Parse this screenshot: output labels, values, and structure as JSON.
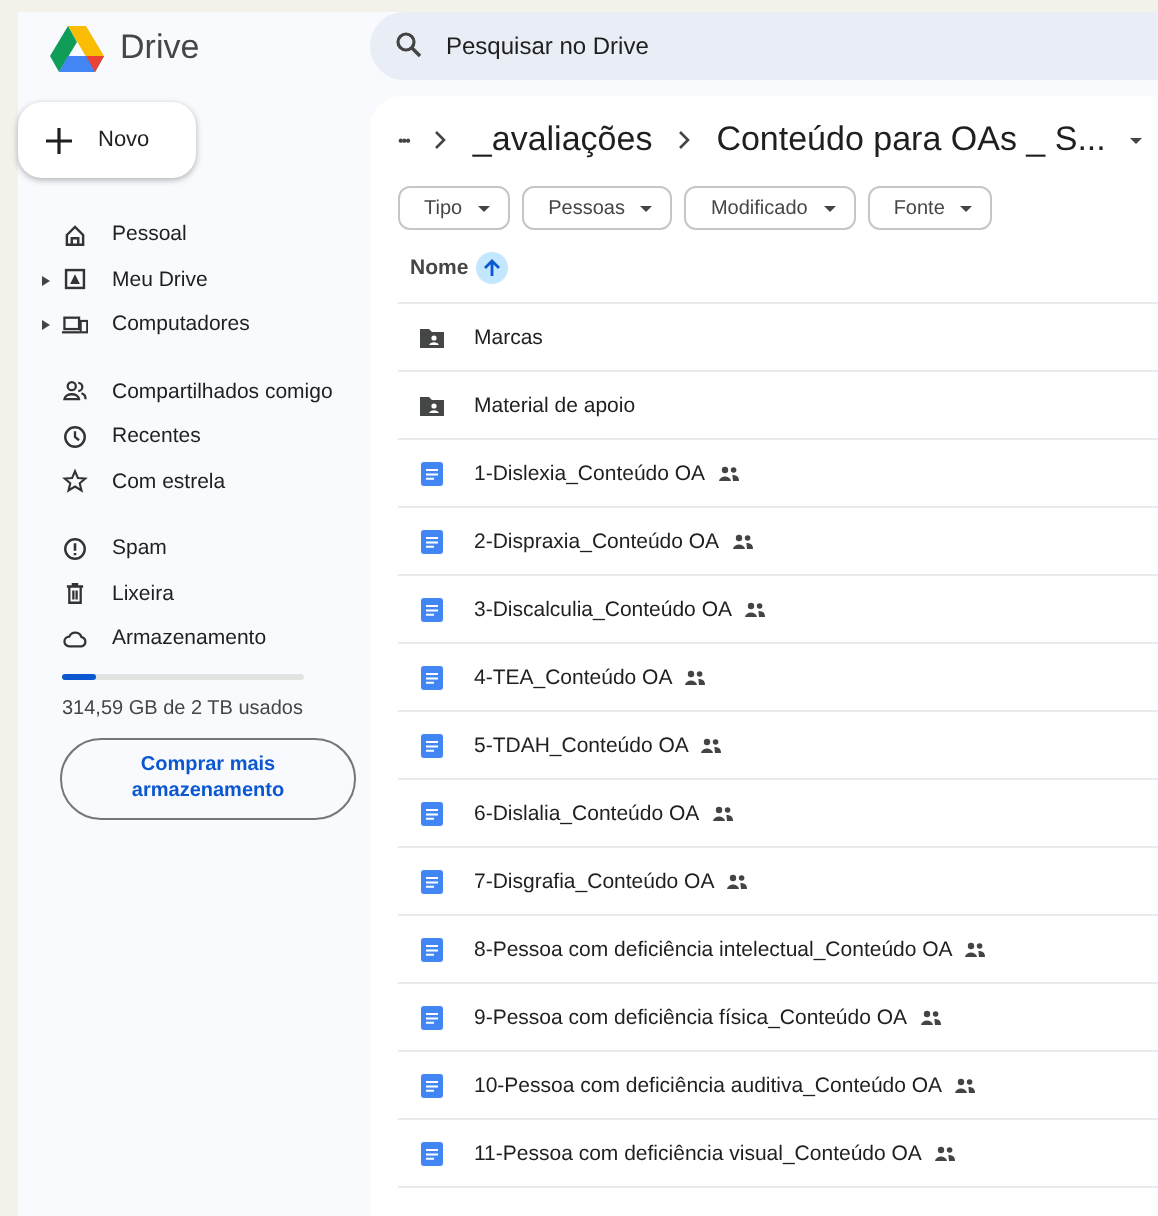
{
  "app": {
    "name": "Drive"
  },
  "search": {
    "placeholder": "Pesquisar no Drive"
  },
  "new_button": {
    "label": "Novo"
  },
  "sidebar": {
    "groups": [
      [
        {
          "label": "Pessoal",
          "expandable": false
        },
        {
          "label": "Meu Drive",
          "expandable": true
        },
        {
          "label": "Computadores",
          "expandable": true
        }
      ],
      [
        {
          "label": "Compartilhados comigo",
          "expandable": false
        },
        {
          "label": "Recentes",
          "expandable": false
        },
        {
          "label": "Com estrela",
          "expandable": false
        }
      ],
      [
        {
          "label": "Spam",
          "expandable": false
        },
        {
          "label": "Lixeira",
          "expandable": false
        },
        {
          "label": "Armazenamento",
          "expandable": false
        }
      ]
    ]
  },
  "storage": {
    "level": 0.14,
    "usage": "314,59 GB de 2 TB usados",
    "button": "Comprar mais armazenamento"
  },
  "breadcrumb": {
    "more": "•••",
    "items": [
      "_avaliações",
      "Conteúdo para OAs _ S..."
    ]
  },
  "filters": [
    "Tipo",
    "Pessoas",
    "Modificado",
    "Fonte"
  ],
  "table": {
    "sort_column": "Nome",
    "rows": [
      {
        "name": "Marcas",
        "kind": "folder",
        "shared": false
      },
      {
        "name": "Material de apoio",
        "kind": "folder",
        "shared": false
      },
      {
        "name": "1-Dislexia_Conteúdo OA",
        "kind": "doc",
        "shared": true
      },
      {
        "name": "2-Dispraxia_Conteúdo OA",
        "kind": "doc",
        "shared": true
      },
      {
        "name": "3-Discalculia_Conteúdo OA",
        "kind": "doc",
        "shared": true
      },
      {
        "name": "4-TEA_Conteúdo OA",
        "kind": "doc",
        "shared": true
      },
      {
        "name": "5-TDAH_Conteúdo OA",
        "kind": "doc",
        "shared": true
      },
      {
        "name": "6-Dislalia_Conteúdo OA",
        "kind": "doc",
        "shared": true
      },
      {
        "name": "7-Disgrafia_Conteúdo OA",
        "kind": "doc",
        "shared": true
      },
      {
        "name": "8-Pessoa com deficiência intelectual_Conteúdo OA",
        "kind": "doc",
        "shared": true
      },
      {
        "name": "9-Pessoa com deficiência física_Conteúdo OA",
        "kind": "doc",
        "shared": true
      },
      {
        "name": "10-Pessoa com deficiência auditiva_Conteúdo OA",
        "kind": "doc",
        "shared": true
      },
      {
        "name": "11-Pessoa com deficiência visual_Conteúdo OA",
        "kind": "doc",
        "shared": true
      }
    ]
  }
}
